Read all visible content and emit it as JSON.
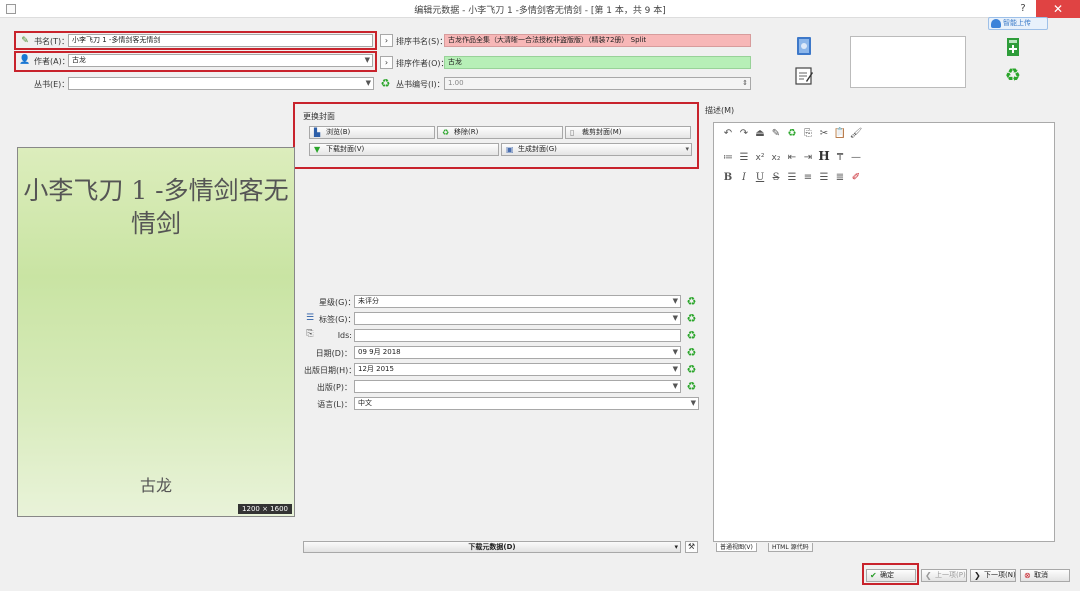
{
  "window": {
    "title": "编辑元数据 - 小李飞刀 1 -多情剑客无情剑 - [第 1 本，共 9 本]",
    "help": "?",
    "close": "✕"
  },
  "cloud_badge": "智能上传",
  "fields": {
    "title": {
      "label": "书名(T)：",
      "value": "小李飞刀 1 -多情剑客无情剑"
    },
    "author": {
      "label": "作者(A)：",
      "value": "古龙"
    },
    "series": {
      "label": "丛书(E)：",
      "value": ""
    },
    "title_sort": {
      "label": "排序书名(S)：",
      "value": "古龙作品全集（大清晰一合法授权非盗版版）（精装72册） Split"
    },
    "author_sort": {
      "label": "排序作者(O)：",
      "value": "古龙"
    },
    "series_index": {
      "label": "丛书编号(I)：",
      "value": "1.00"
    }
  },
  "cover": {
    "title": "小李飞刀 1 -多情剑客无情剑",
    "author": "古龙",
    "size": "1200 × 1600",
    "change_label": "更换封面",
    "buttons": {
      "browse": "浏览(B)",
      "remove": "移除(R)",
      "trim": "裁剪封面(M)",
      "download": "下载封面(V)",
      "generate": "生成封面(G)"
    }
  },
  "meta": {
    "rating": {
      "label": "星级(G)：",
      "value": "未评分"
    },
    "tags": {
      "label": "标签(G)：",
      "value": ""
    },
    "ids": {
      "label": "Ids:",
      "value": ""
    },
    "date": {
      "label": "日期(D)：",
      "value": "09 9月 2018"
    },
    "pubdate": {
      "label": "出版日期(H)：",
      "value": "12月 2015"
    },
    "publisher": {
      "label": "出版(P)：",
      "value": ""
    },
    "language": {
      "label": "语言(L)：",
      "value": "中文"
    }
  },
  "comments": {
    "label": "描述(M)",
    "tabs": [
      "普通视图(V)",
      "HTML 源代码"
    ]
  },
  "download_metadata": "下载元数据(D)",
  "bottom_buttons": {
    "ok": "确定",
    "prev": "上一项(P)",
    "next": "下一项(N)",
    "cancel": "取消"
  },
  "colors": {
    "highlight": "#c8232c",
    "title_sort_bg": "#f7b7b7",
    "author_sort_bg": "#b7efb7"
  }
}
